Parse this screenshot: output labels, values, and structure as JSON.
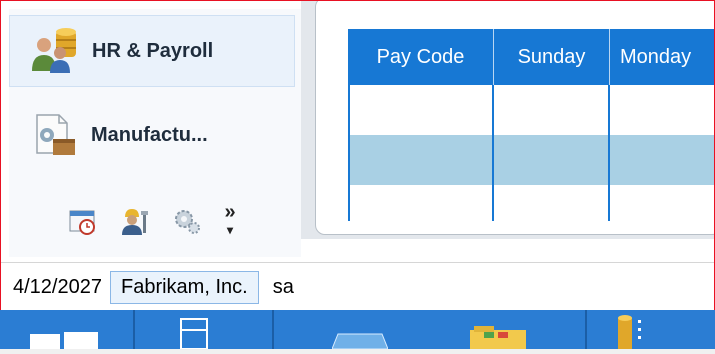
{
  "nav": {
    "items": [
      {
        "label": "HR & Payroll",
        "icon": "hr-payroll-icon",
        "selected": true
      },
      {
        "label": "Manufactu...",
        "icon": "manufacturing-icon",
        "selected": false
      }
    ],
    "mini_icons": [
      "calendar-clock-icon",
      "worker-tools-icon",
      "gears-icon"
    ],
    "more_glyph": "»"
  },
  "grid": {
    "columns": [
      "Pay Code",
      "Sunday",
      "Monday"
    ],
    "rows": [
      {
        "highlighted": false
      },
      {
        "highlighted": true
      },
      {
        "highlighted": false
      }
    ]
  },
  "status": {
    "date": "4/12/2027",
    "company": "Fabrikam, Inc.",
    "user": "sa"
  },
  "taskbar": {
    "buttons": [
      "windows-start-icon",
      "app-window-icon",
      "mail-icon",
      "folder-icon",
      "database-icon"
    ]
  },
  "colors": {
    "grid_header": "#1778d4",
    "row_highlight": "#a9d0e4",
    "window_border": "#e81123",
    "taskbar": "#2b7dd3"
  }
}
